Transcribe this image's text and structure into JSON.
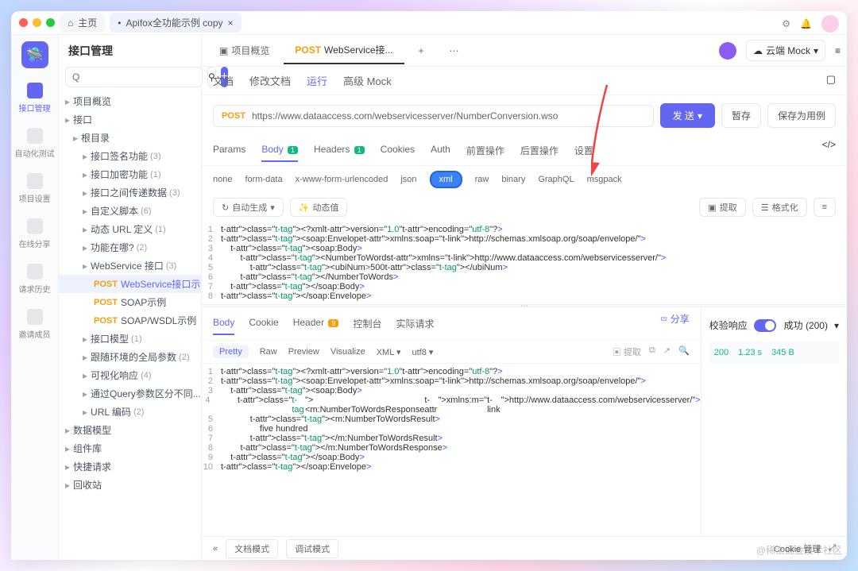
{
  "titlebar": {
    "home": "主页",
    "activeTab": "Apifox全功能示例 copy",
    "close": "×"
  },
  "leftnav": {
    "items": [
      "接口管理",
      "自动化测试",
      "项目设置",
      "在线分享",
      "请求历史",
      "邀请成员"
    ]
  },
  "sidebar": {
    "title": "接口管理",
    "search_placeholder": "Q",
    "rows": [
      {
        "label": "项目概览",
        "ind": 0
      },
      {
        "label": "接口",
        "ind": 0
      },
      {
        "label": "根目录",
        "ind": 1
      },
      {
        "label": "接口签名功能",
        "cnt": "(3)",
        "ind": 2
      },
      {
        "label": "接口加密功能",
        "cnt": "(1)",
        "ind": 2
      },
      {
        "label": "接口之间传递数据",
        "cnt": "(3)",
        "ind": 2
      },
      {
        "label": "自定义脚本",
        "cnt": "(6)",
        "ind": 2
      },
      {
        "label": "动态 URL 定义",
        "cnt": "(1)",
        "ind": 2
      },
      {
        "label": "功能在哪?",
        "cnt": "(2)",
        "ind": 2
      },
      {
        "label": "WebService 接口",
        "cnt": "(3)",
        "ind": 2
      },
      {
        "method": "POST",
        "label": "WebService接口示例",
        "ind": 3,
        "sel": true
      },
      {
        "method": "POST",
        "label": "SOAP示例",
        "ind": 3
      },
      {
        "method": "POST",
        "label": "SOAP/WSDL示例",
        "ind": 3
      },
      {
        "label": "接口模型",
        "cnt": "(1)",
        "ind": 2
      },
      {
        "label": "跟随环境的全局参数",
        "cnt": "(2)",
        "ind": 2
      },
      {
        "label": "可视化响应",
        "cnt": "(4)",
        "ind": 2
      },
      {
        "label": "通过Query参数区分不同...",
        "cnt": "(1)",
        "ind": 2
      },
      {
        "label": "URL 编码",
        "cnt": "(2)",
        "ind": 2
      },
      {
        "label": "数据模型",
        "ind": 0
      },
      {
        "label": "组件库",
        "ind": 0
      },
      {
        "label": "快捷请求",
        "ind": 0
      },
      {
        "label": "回收站",
        "ind": 0
      }
    ]
  },
  "tabs": {
    "overview": "项目概览",
    "active": "WebService接...",
    "method": "POST",
    "mock": "云端 Mock"
  },
  "subtabs": [
    "文档",
    "修改文档",
    "运行",
    "高级 Mock"
  ],
  "subtab_active": 2,
  "url": {
    "method": "POST",
    "value": "https://www.dataaccess.com/webservicesserver/NumberConversion.wso",
    "send": "发 送",
    "save": "暂存",
    "saveas": "保存为用例"
  },
  "paramtabs": [
    {
      "t": "Params"
    },
    {
      "t": "Body",
      "b": "1",
      "a": true
    },
    {
      "t": "Headers",
      "b": "1"
    },
    {
      "t": "Cookies"
    },
    {
      "t": "Auth"
    },
    {
      "t": "前置操作"
    },
    {
      "t": "后置操作"
    },
    {
      "t": "设置"
    }
  ],
  "bodytypes": [
    "none",
    "form-data",
    "x-www-form-urlencoded",
    "json",
    "xml",
    "raw",
    "binary",
    "GraphQL",
    "msgpack"
  ],
  "bodytype_active": 4,
  "toolbar": {
    "autogen": "自动生成",
    "dynamic": "动态值",
    "extract": "提取",
    "format": "格式化"
  },
  "reqlines": [
    "<?xml version=\"1.0\" encoding=\"utf-8\"?>",
    "<soap:Envelope xmlns:soap=\"http://schemas.xmlsoap.org/soap/envelope/\">",
    "    <soap:Body>",
    "        <NumberToWords xmlns=\"http://www.dataaccess.com/webservicesserver/\">",
    "            <ubiNum>500</ubiNum>",
    "        </NumberToWords>",
    "    </soap:Body>",
    "</soap:Envelope>"
  ],
  "resptabs": [
    {
      "t": "Body",
      "a": true
    },
    {
      "t": "Cookie"
    },
    {
      "t": "Header",
      "b": "9"
    },
    {
      "t": "控制台"
    },
    {
      "t": "实际请求"
    }
  ],
  "share": "分享",
  "subtabs2": [
    "Pretty",
    "Raw",
    "Preview",
    "Visualize",
    "XML",
    "utf8"
  ],
  "extract2": "提取",
  "resplines": [
    "<?xml version=\"1.0\" encoding=\"utf-8\"?>",
    "<soap:Envelope xmlns:soap=\"http://schemas.xmlsoap.org/soap/envelope/\">",
    "    <soap:Body>",
    "        <m:NumberToWordsResponse xmlns:m=\"http://www.dataaccess.com/webservicesserver/\">",
    "            <m:NumberToWordsResult>",
    "                five hundred ",
    "            </m:NumberToWordsResult>",
    "        </m:NumberToWordsResponse>",
    "    </soap:Body>",
    "</soap:Envelope>"
  ],
  "respright": {
    "check": "校验响应",
    "status": "成功 (200)",
    "code": "200",
    "time": "1.23 s",
    "size": "345 B"
  },
  "bottom": {
    "doc": "文档模式",
    "debug": "调试模式",
    "cookie": "Cookie 管理"
  },
  "watermark": "@稀土掘金技术社区"
}
